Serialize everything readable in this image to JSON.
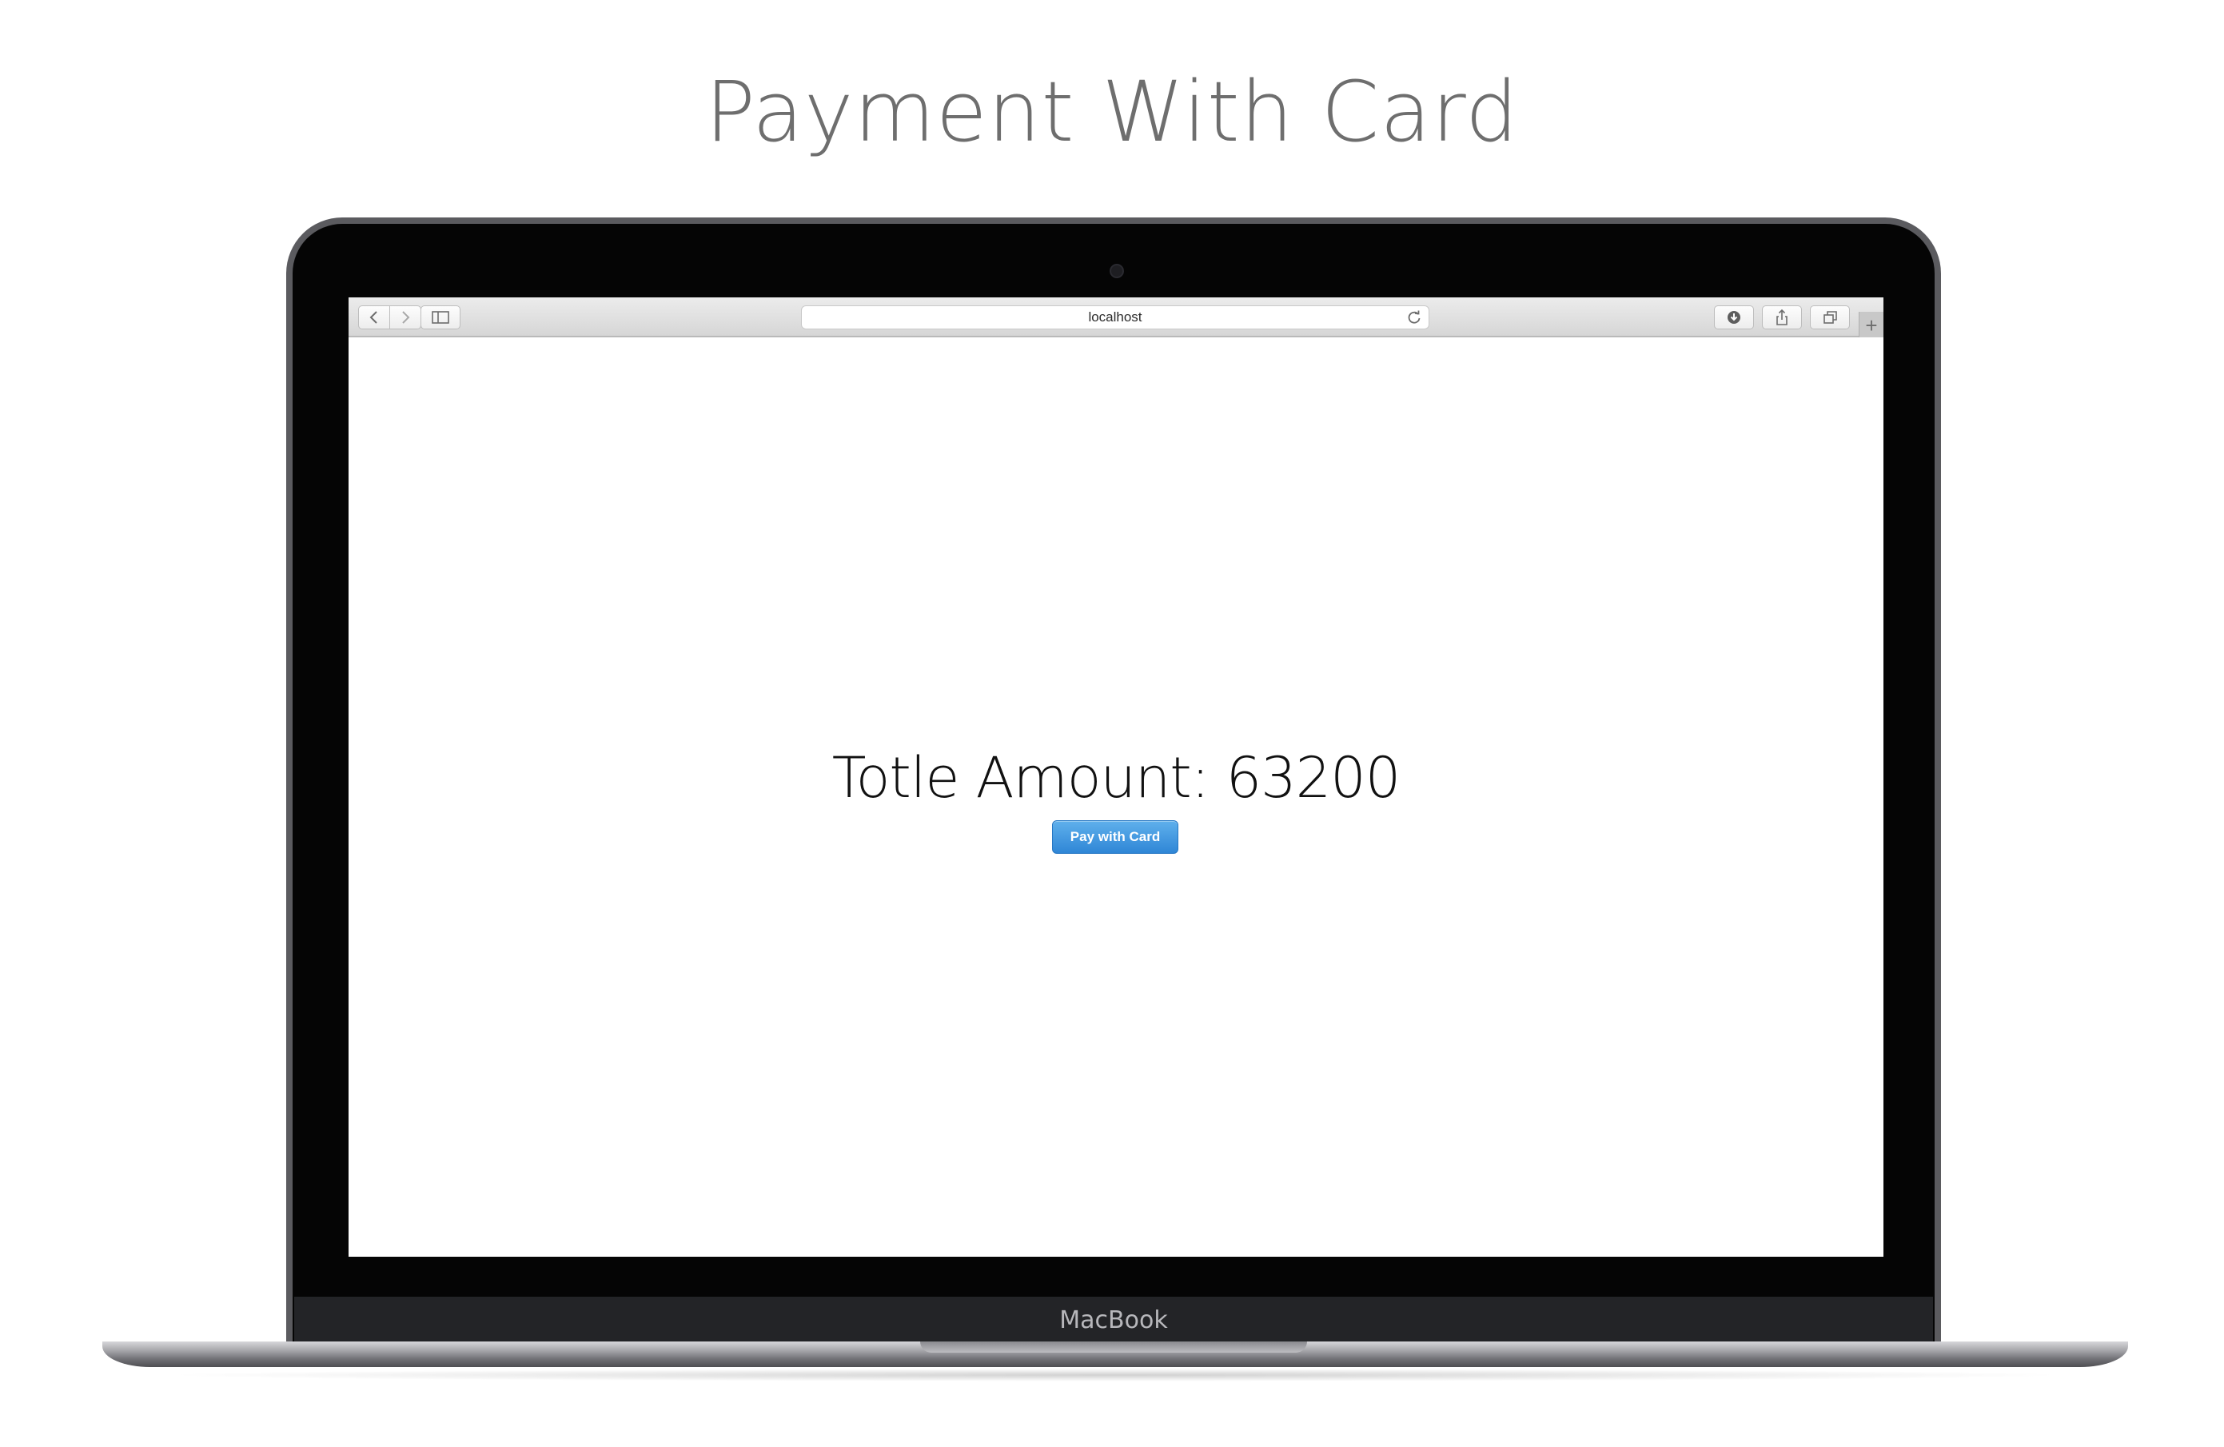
{
  "page": {
    "title": "Payment With Card"
  },
  "device": {
    "label": "MacBook"
  },
  "browser": {
    "address": "localhost",
    "icons": {
      "back": "chevron-left-icon",
      "forward": "chevron-right-icon",
      "sidebar": "sidebar-icon",
      "reload": "reload-icon",
      "download": "download-icon",
      "share": "share-icon",
      "tabs": "tabs-icon",
      "new_tab": "plus-icon"
    },
    "new_tab_glyph": "+"
  },
  "content": {
    "amount_label": "Totle Amount:",
    "amount_value": "63200",
    "pay_button_label": "Pay with Card"
  },
  "colors": {
    "pay_button": "#2f86d6",
    "title_text": "#6e6e6e"
  }
}
